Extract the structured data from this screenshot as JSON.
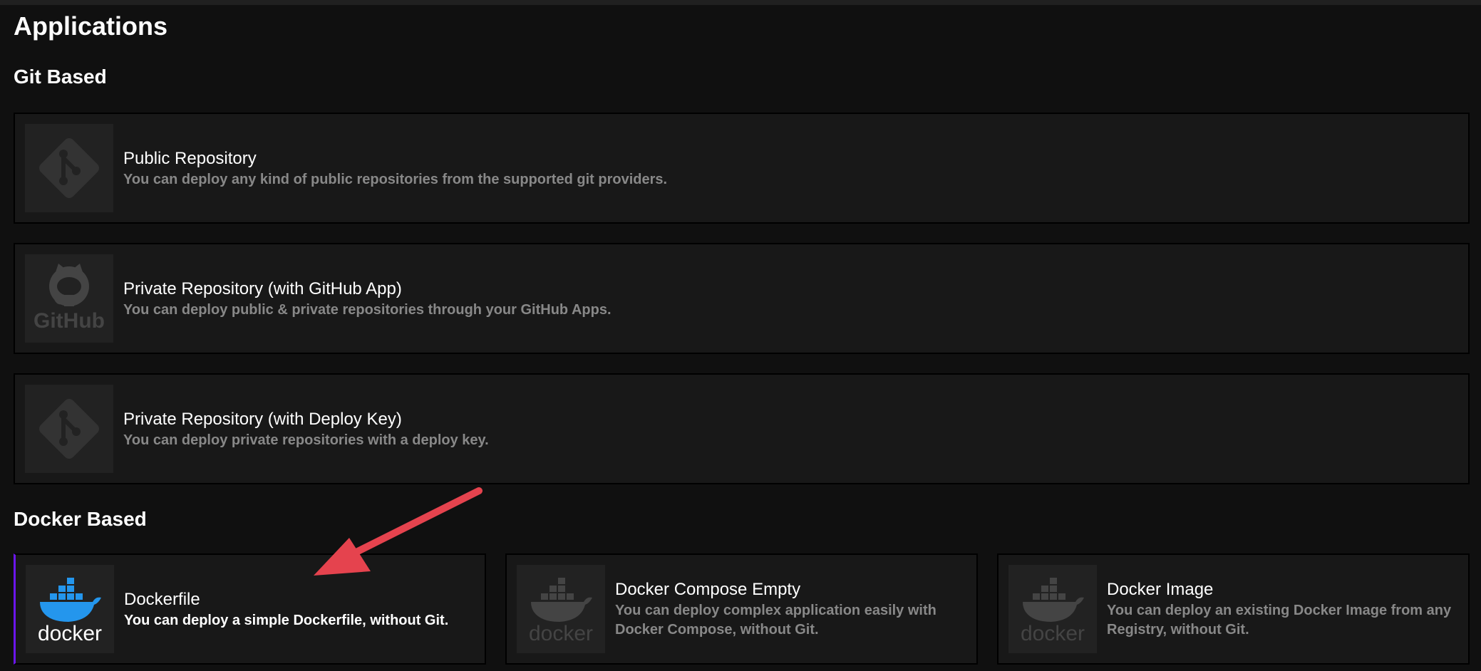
{
  "page": {
    "title": "Applications"
  },
  "sections": {
    "git": {
      "title": "Git Based",
      "cards": [
        {
          "title": "Public Repository",
          "desc": "You can deploy any kind of public repositories from the supported git providers.",
          "icon": "git-icon"
        },
        {
          "title": "Private Repository (with GitHub App)",
          "desc": "You can deploy public & private repositories through your GitHub Apps.",
          "icon": "github-icon",
          "logo_text": "GitHub"
        },
        {
          "title": "Private Repository (with Deploy Key)",
          "desc": "You can deploy private repositories with a deploy key.",
          "icon": "git-icon"
        }
      ]
    },
    "docker": {
      "title": "Docker Based",
      "cards": [
        {
          "title": "Dockerfile",
          "desc": "You can deploy a simple Dockerfile, without Git.",
          "icon": "docker-icon",
          "logo_text": "docker",
          "selected": true
        },
        {
          "title": "Docker Compose Empty",
          "desc": "You can deploy complex application easily with Docker Compose, without Git.",
          "icon": "docker-icon",
          "logo_text": "docker"
        },
        {
          "title": "Docker Image",
          "desc": "You can deploy an existing Docker Image from any Registry, without Git.",
          "icon": "docker-icon",
          "logo_text": "docker"
        }
      ]
    }
  },
  "colors": {
    "background": "#101010",
    "card": "#181818",
    "logo_bg": "#222222",
    "selected_accent": "#6b16ed",
    "annotation_arrow": "#e5434e",
    "docker_blue": "#2496ed"
  }
}
